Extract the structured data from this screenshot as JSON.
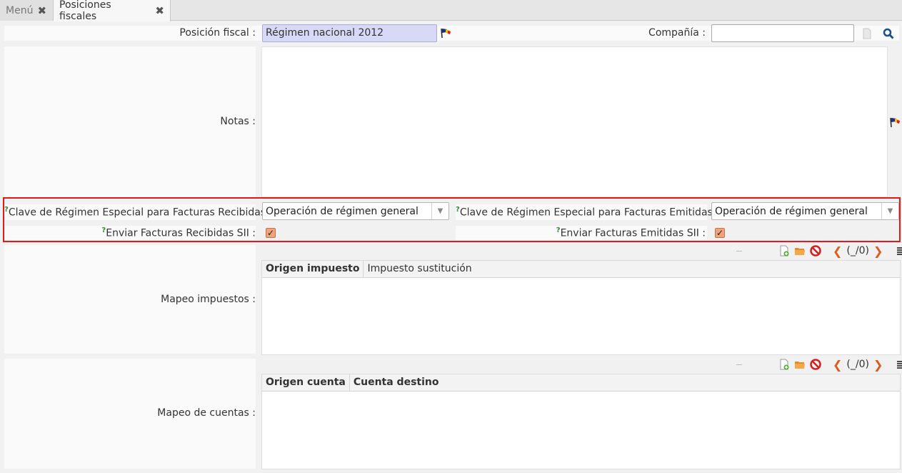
{
  "tabs": [
    {
      "label": "Menú"
    },
    {
      "label": "Posiciones fiscales"
    }
  ],
  "form": {
    "posicion_fiscal_label": "Posición fiscal :",
    "posicion_fiscal_value": "Régimen nacional 2012",
    "compania_label": "Compañía :",
    "compania_value": "",
    "notas_label": "Notas :",
    "clave_recibidas_label": "Clave de Régimen Especial para Facturas Recibidas :",
    "clave_recibidas_value": "Operación de régimen general",
    "clave_emitidas_label": "Clave de Régimen Especial para Facturas Emitidas :",
    "clave_emitidas_value": "Operación de régimen general",
    "enviar_recibidas_label": "Enviar Facturas Recibidas SII :",
    "enviar_recibidas_checked": true,
    "enviar_emitidas_label": "Enviar Facturas Emitidas SII :",
    "enviar_emitidas_checked": true,
    "help_mark": "?"
  },
  "mapeo_impuestos": {
    "label": "Mapeo impuestos :",
    "pager": "(_/0)",
    "columns": [
      "Origen impuesto",
      "Impuesto sustitución"
    ]
  },
  "mapeo_cuentas": {
    "label": "Mapeo de cuentas :",
    "pager": "(_/0)",
    "columns": [
      "Origen cuenta",
      "Cuenta destino"
    ]
  },
  "colors": {
    "highlight": "#e31818",
    "accent": "#e05a1a",
    "selected_field": "#d7d9f7"
  }
}
